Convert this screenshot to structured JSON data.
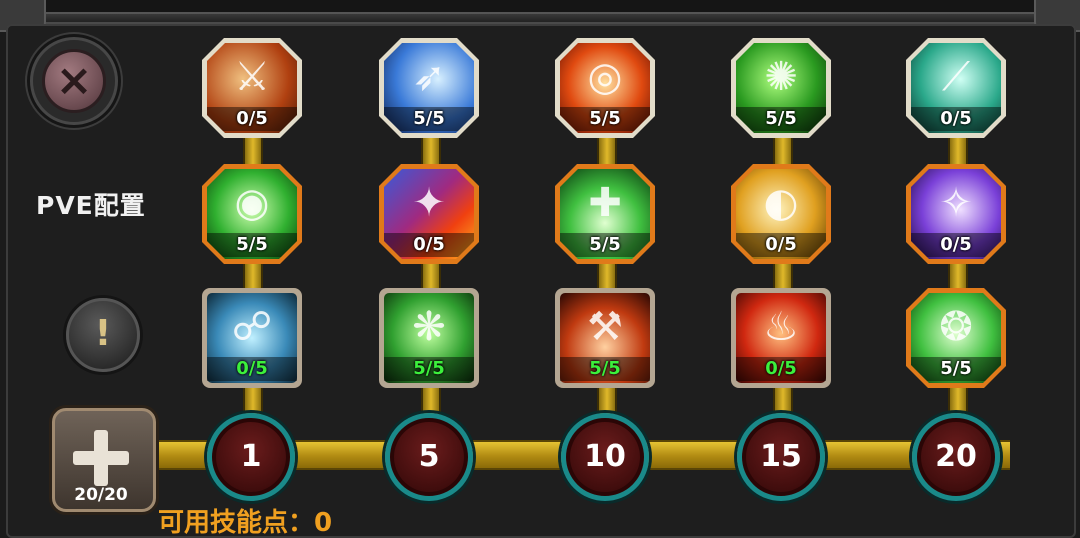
{
  "header": {
    "close_icon": "×",
    "warning_icon": "!"
  },
  "side": {
    "config_label": "PVE配置"
  },
  "points": {
    "count": "20/20",
    "available_label": "可用技能点：0"
  },
  "milestones": [
    "1",
    "5",
    "10",
    "15",
    "20"
  ],
  "colors": {
    "rank_bar": "#d4ad1f",
    "node_ring": "#1a8a8a",
    "node_fill": "#5a1616",
    "active_text": "#3cf03c"
  },
  "skills": {
    "row1": [
      {
        "level": "0/5",
        "icon": "sword-skill-icon",
        "glyph": "⚔"
      },
      {
        "level": "5/5",
        "icon": "arrow-burst-skill-icon",
        "glyph": "➶"
      },
      {
        "level": "5/5",
        "icon": "target-skill-icon",
        "glyph": "◎"
      },
      {
        "level": "5/5",
        "icon": "poison-splash-skill-icon",
        "glyph": "✺"
      },
      {
        "level": "0/5",
        "icon": "blade-slash-skill-icon",
        "glyph": "⟋"
      }
    ],
    "row2": [
      {
        "level": "5/5",
        "icon": "eye-shield-skill-icon",
        "glyph": "◉"
      },
      {
        "level": "0/5",
        "icon": "fire-blade-skill-icon",
        "glyph": "✦"
      },
      {
        "level": "5/5",
        "icon": "heal-rise-skill-icon",
        "glyph": "✚"
      },
      {
        "level": "0/5",
        "icon": "golden-shield-skill-icon",
        "glyph": "◐"
      },
      {
        "level": "0/5",
        "icon": "arcane-flame-skill-icon",
        "glyph": "✧"
      }
    ],
    "row3": [
      {
        "level": "0/5",
        "icon": "dash-runner-skill-icon",
        "glyph": "☍"
      },
      {
        "level": "5/5",
        "icon": "green-beast-skill-icon",
        "glyph": "❋"
      },
      {
        "level": "5/5",
        "icon": "hammer-strike-skill-icon",
        "glyph": "⚒"
      },
      {
        "level": "0/5",
        "icon": "fire-helm-skill-icon",
        "glyph": "♨"
      },
      {
        "level": "5/5",
        "icon": "green-aura-skill-icon",
        "glyph": "❂"
      }
    ]
  }
}
